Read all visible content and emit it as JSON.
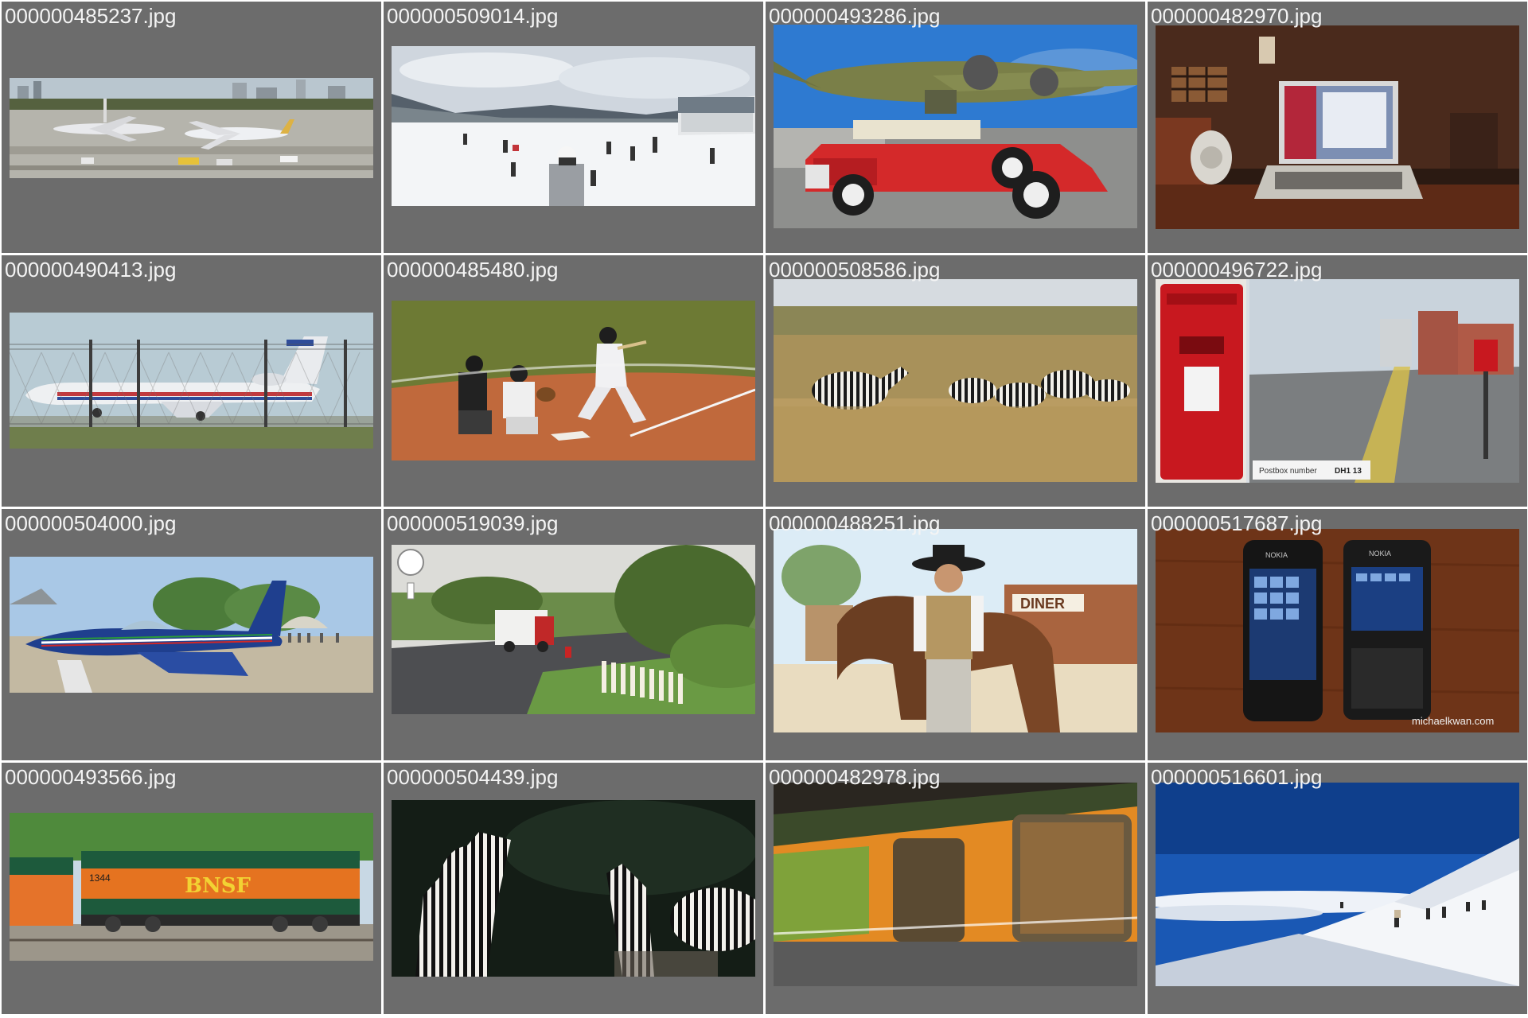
{
  "thumbnails": [
    {
      "filename": "000000485237.jpg",
      "subject": "airport tarmac with jumbo jets and city skyline"
    },
    {
      "filename": "000000509014.jpg",
      "subject": "ski slope with skiers and lodge"
    },
    {
      "filename": "000000493286.jpg",
      "subject": "red vintage convertible car in front of B-17 bomber"
    },
    {
      "filename": "000000482970.jpg",
      "subject": "laptop on desk with speaker in dim room"
    },
    {
      "filename": "000000490413.jpg",
      "subject": "regional jet behind chain-link fence"
    },
    {
      "filename": "000000485480.jpg",
      "subject": "baseball batter, catcher and umpire at home plate"
    },
    {
      "filename": "000000508586.jpg",
      "subject": "herd of zebras in tall savanna grass"
    },
    {
      "filename": "000000496722.jpg",
      "subject": "Royal Mail postbox and suburban street",
      "caption": "Postbox number",
      "caption_value": "DH1 13"
    },
    {
      "filename": "000000504000.jpg",
      "subject": "blue jet trainer aircraft at air show"
    },
    {
      "filename": "000000519039.jpg",
      "subject": "street view with garbage truck and picket fence"
    },
    {
      "filename": "000000488251.jpg",
      "subject": "cowboy standing with horse in front of diner",
      "sign": "DINER"
    },
    {
      "filename": "000000517687.jpg",
      "subject": "two Nokia mobile phones on wooden table",
      "brand": "NOKIA",
      "watermark": "michaelkwan.com"
    },
    {
      "filename": "000000493566.jpg",
      "subject": "orange and green BNSF locomotive",
      "lettering": "BNSF",
      "unit_number": "1344"
    },
    {
      "filename": "000000504439.jpg",
      "subject": "two zebras at night"
    },
    {
      "filename": "000000482978.jpg",
      "subject": "orange passenger train in station"
    },
    {
      "filename": "000000516601.jpg",
      "subject": "skiers on snowy mountain ridge above clouds"
    }
  ],
  "colors": {
    "cell_background": "#6c6c6c",
    "filename_text": "#f4f4f4"
  }
}
